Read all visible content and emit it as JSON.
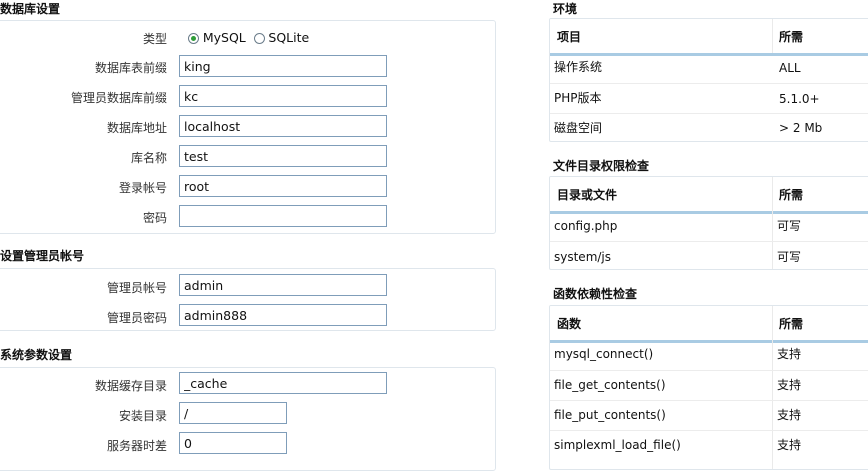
{
  "db_settings": {
    "title": "数据库设置",
    "type_label": "类型",
    "type_options": [
      "MySQL",
      "SQLite"
    ],
    "type_selected": "MySQL",
    "fields": [
      {
        "label": "数据库表前缀",
        "value": "king"
      },
      {
        "label": "管理员数据库前缀",
        "value": "kc"
      },
      {
        "label": "数据库地址",
        "value": "localhost"
      },
      {
        "label": "库名称",
        "value": "test"
      },
      {
        "label": "登录帐号",
        "value": "root"
      },
      {
        "label": "密码",
        "value": ""
      }
    ]
  },
  "admin_settings": {
    "title": "设置管理员帐号",
    "fields": [
      {
        "label": "管理员帐号",
        "value": "admin"
      },
      {
        "label": "管理员密码",
        "value": "admin888"
      }
    ]
  },
  "system_settings": {
    "title": "系统参数设置",
    "fields": [
      {
        "label": "数据缓存目录",
        "value": "_cache"
      },
      {
        "label": "安装目录",
        "value": "/"
      },
      {
        "label": "服务器时差",
        "value": "0"
      }
    ]
  },
  "environment": {
    "title": "环境",
    "headers": [
      "项目",
      "所需"
    ],
    "rows": [
      [
        "操作系统",
        "ALL"
      ],
      [
        "PHP版本",
        "5.1.0+"
      ],
      [
        "磁盘空间",
        "> 2 Mb"
      ]
    ]
  },
  "dir_check": {
    "title": "文件目录权限检查",
    "headers": [
      "目录或文件",
      "所需"
    ],
    "rows": [
      [
        "config.php",
        "可写"
      ],
      [
        "system/js",
        "可写"
      ]
    ]
  },
  "func_check": {
    "title": "函数依赖性检查",
    "headers": [
      "函数",
      "所需"
    ],
    "rows": [
      [
        "mysql_connect()",
        "支持"
      ],
      [
        "file_get_contents()",
        "支持"
      ],
      [
        "file_put_contents()",
        "支持"
      ],
      [
        "simplexml_load_file()",
        "支持"
      ]
    ]
  }
}
